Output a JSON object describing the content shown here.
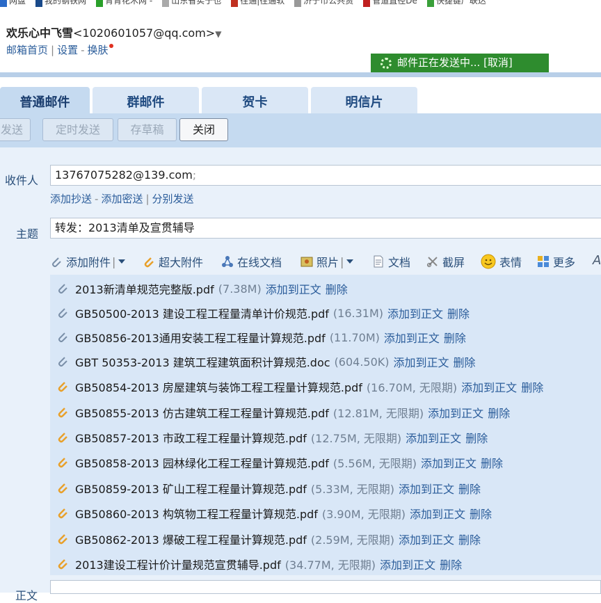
{
  "bookmarks": [
    "网盘",
    "我的钢铁网",
    "青青花木网 -",
    "山东省实于也",
    "往通|往通软",
    "济宁市公共资",
    "管道直径De",
    "快捷键广联达"
  ],
  "header": {
    "account_name": "欢乐心中飞雪",
    "account_email": "<1020601057@qq.com>",
    "dropdown_arrow": "▼",
    "link_home": "邮箱首页",
    "link_settings": "设置",
    "link_skin": "换肤"
  },
  "status": {
    "text": "邮件正在发送中... [取消]",
    "color": "#2e8c2e"
  },
  "tabs": [
    "普通邮件",
    "群邮件",
    "贺卡",
    "明信片"
  ],
  "toolbar": {
    "send": "发送",
    "scheduled": "定时发送",
    "draft": "存草稿",
    "close": "关闭"
  },
  "compose": {
    "to_label": "收件人",
    "to_value": "13767075282@139.com",
    "to_semicolon": ";",
    "add_cc": "添加抄送",
    "add_bcc": "添加密送",
    "separate_send": "分别发送",
    "subject_label": "主题",
    "subject_value": "转发：2013清单及宣贯辅导",
    "body_label": "正文"
  },
  "attach_toolbar": {
    "add_attachment": "添加附件",
    "large_attachment": "超大附件",
    "online_doc": "在线文档",
    "photo": "照片",
    "document": "文档",
    "screenshot": "截屏",
    "emoji": "表情",
    "more": "更多"
  },
  "attachment_actions": {
    "add_to_body": "添加到正文",
    "delete": "删除"
  },
  "attachments": [
    {
      "name": "2013新清单规范完整版.pdf",
      "size": "(7.38M)",
      "type": "normal"
    },
    {
      "name": "GB50500-2013 建设工程工程量清单计价规范.pdf",
      "size": "(16.31M)",
      "type": "normal"
    },
    {
      "name": "GB50856-2013通用安装工程工程量计算规范.pdf",
      "size": "(11.70M)",
      "type": "normal"
    },
    {
      "name": "GBT 50353-2013 建筑工程建筑面积计算规范.doc",
      "size": "(604.50K)",
      "type": "normal"
    },
    {
      "name": "GB50854-2013 房屋建筑与装饰工程工程量计算规范.pdf",
      "size": "(16.70M, 无限期)",
      "type": "large"
    },
    {
      "name": "GB50855-2013 仿古建筑工程工程量计算规范.pdf",
      "size": "(12.81M, 无限期)",
      "type": "large"
    },
    {
      "name": "GB50857-2013 市政工程工程量计算规范.pdf",
      "size": "(12.75M, 无限期)",
      "type": "large"
    },
    {
      "name": "GB50858-2013 园林绿化工程工程量计算规范.pdf",
      "size": "(5.56M, 无限期)",
      "type": "large"
    },
    {
      "name": "GB50859-2013 矿山工程工程量计算规范.pdf",
      "size": "(5.33M, 无限期)",
      "type": "large"
    },
    {
      "name": "GB50860-2013 构筑物工程工程量计算规范.pdf",
      "size": "(3.90M, 无限期)",
      "type": "large"
    },
    {
      "name": "GB50862-2013 爆破工程工程量计算规范.pdf",
      "size": "(2.59M, 无限期)",
      "type": "large"
    },
    {
      "name": "2013建设工程计价计量规范宣贯辅导.pdf",
      "size": "(34.77M, 无限期)",
      "type": "large"
    }
  ]
}
